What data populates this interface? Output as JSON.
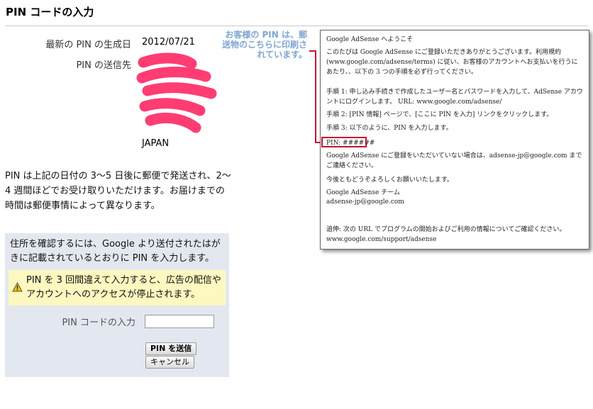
{
  "page": {
    "title": "PIN コードの入力"
  },
  "info": {
    "generated_label": "最新の PIN の生成日",
    "generated_value": "2012/07/21",
    "sent_to_label": "PIN の送信先",
    "address_country": "JAPAN"
  },
  "note": "PIN は上記の日付の 3〜5 日後に郵便で発送され、2〜4 週間ほどでお受け取りいただけます。お届けまでの時間は郵便事情によって異なります。",
  "form": {
    "intro": "住所を確認するには、Google より送付されたはがきに記載されているとおりに PIN を入力します。",
    "warning": "PIN を 3 回間違えて入力すると、広告の配信やアカウントへのアクセスが停止されます。",
    "pin_label": "PIN コードの入力",
    "pin_value": "",
    "submit_label": "PIN を送信",
    "cancel_label": "キャンセル"
  },
  "callout": {
    "text": "お客様の PIN は、郵送物のこちらに印刷されています。"
  },
  "letter": {
    "greeting": "Google AdSense へようこそ",
    "intro": "このたびは Google AdSense にご登録いただきありがとうございます。利用規約 (www.google.com/adsense/terms) に従い、お客様のアカウントへお支払いを行うにあたり、、以下の 3 つの手順を必ず行ってください。",
    "step1": "手順 1: 申し込み手続きで作成したユーザー名とパスワードを入力して、AdSense アカウントにログインします。 URL: www.google.com/adsense/",
    "step2": "手順 2: [PIN 情報] ページで、[ここに PIN を入力] リンクをクリックします。",
    "step3": "手順 3: 以下のように、PIN を入力します。",
    "pin_line": "PIN: ######",
    "unregistered": "Google AdSense にご登録をいただいていない場合は、adsense-jp@google.com までご連絡ください。",
    "closing": "今後ともどうぞよろしくお願いいたします。",
    "team": "Google AdSense チーム",
    "email": "adsense-jp@google.com",
    "ps": "追伸: 次の URL でプログラムの開始およびご利用の情報についてご確認ください。www.google.com/support/adsense"
  },
  "colors": {
    "form_background": "#e3e7f0",
    "warning_background": "#fdf7c0",
    "callout_text": "#7fa5d2",
    "highlight_red": "#c8102e",
    "redaction_pink": "#ff3d73"
  },
  "icons": {
    "warning": "warning-triangle-icon"
  }
}
